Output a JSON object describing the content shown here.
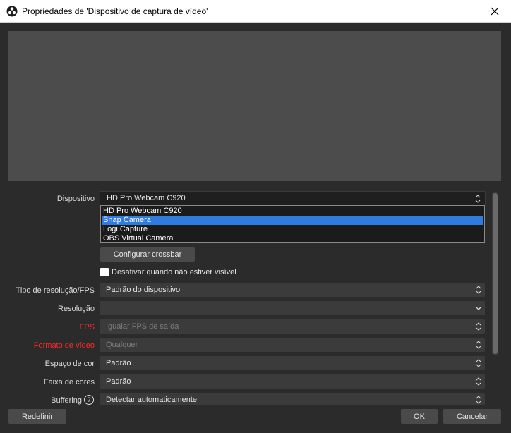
{
  "window": {
    "title": "Propriedades de 'Dispositivo de captura de vídeo'",
    "close_icon": "close-icon"
  },
  "properties": {
    "device": {
      "label": "Dispositivo",
      "selected": "HD Pro Webcam C920",
      "options": [
        "HD Pro Webcam C920",
        "Snap Camera",
        "Logi Capture",
        "OBS Virtual Camera"
      ],
      "highlighted": "Snap Camera"
    },
    "crossbar_button": "Configurar crossbar",
    "deactivate_checkbox": {
      "label": "Desativar quando não estiver visível",
      "checked": false
    },
    "resolution_type": {
      "label": "Tipo de resolução/FPS",
      "value": "Padrão do dispositivo"
    },
    "resolution": {
      "label": "Resolução",
      "value": ""
    },
    "fps": {
      "label": "FPS",
      "value": "Igualar FPS de saída"
    },
    "video_format": {
      "label": "Formato de vídeo",
      "value": "Qualquer"
    },
    "color_space": {
      "label": "Espaço de cor",
      "value": "Padrão"
    },
    "color_range": {
      "label": "Faixa de cores",
      "value": "Padrão"
    },
    "buffering": {
      "label": "Buffering",
      "value": "Detectar automaticamente"
    }
  },
  "footer": {
    "reset_label": "Redefinir",
    "ok_label": "OK",
    "cancel_label": "Cancelar"
  },
  "colors": {
    "background": "#2b2b2b",
    "preview": "#4c4c4c",
    "field": "#3b3b3b",
    "selection": "#2f7be0",
    "warning_label": "#ff2a2a"
  }
}
